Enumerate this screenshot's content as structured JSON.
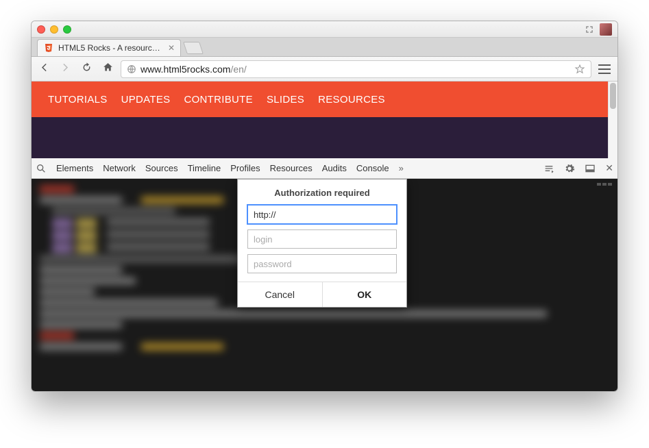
{
  "tab": {
    "title": "HTML5 Rocks - A resource…"
  },
  "omnibox": {
    "host": "www.html5rocks.com",
    "path": "/en/"
  },
  "siteNav": {
    "items": [
      "TUTORIALS",
      "UPDATES",
      "CONTRIBUTE",
      "SLIDES",
      "RESOURCES"
    ]
  },
  "devtools": {
    "tabs": [
      "Elements",
      "Network",
      "Sources",
      "Timeline",
      "Profiles",
      "Resources",
      "Audits",
      "Console"
    ]
  },
  "dialog": {
    "title": "Authorization required",
    "url_value": "http://",
    "login_placeholder": "login",
    "password_placeholder": "password",
    "cancel": "Cancel",
    "ok": "OK"
  }
}
